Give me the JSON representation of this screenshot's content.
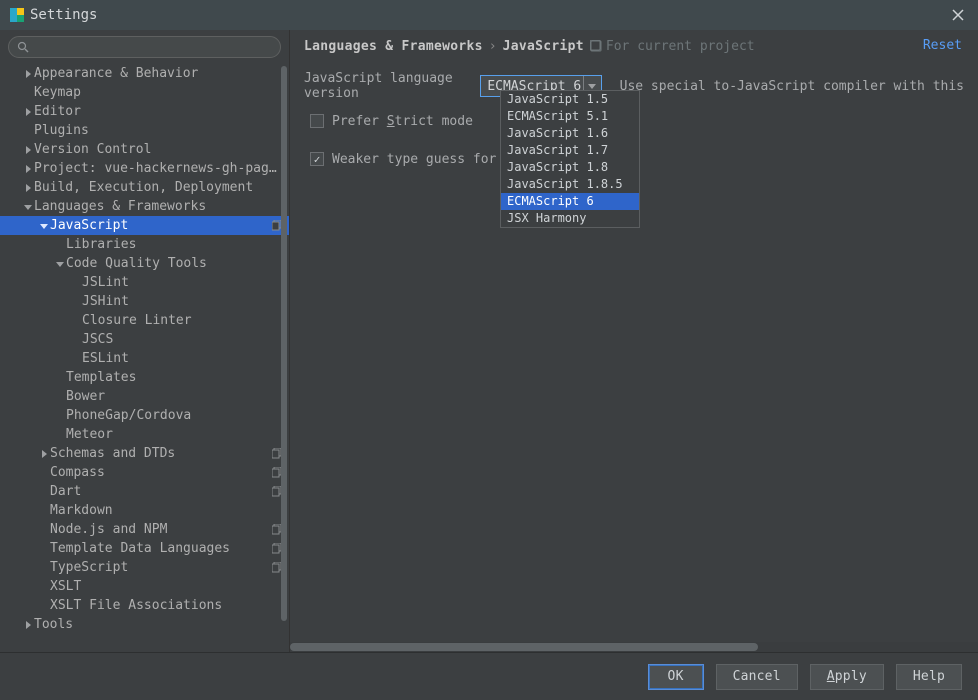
{
  "window": {
    "title": "Settings"
  },
  "search": {
    "placeholder": ""
  },
  "tree": [
    {
      "label": "Appearance & Behavior",
      "indent": 0,
      "arrow": "right"
    },
    {
      "label": "Keymap",
      "indent": 0,
      "arrow": "none"
    },
    {
      "label": "Editor",
      "indent": 0,
      "arrow": "right"
    },
    {
      "label": "Plugins",
      "indent": 0,
      "arrow": "none"
    },
    {
      "label": "Version Control",
      "indent": 0,
      "arrow": "right"
    },
    {
      "label": "Project: vue-hackernews-gh-pag...",
      "indent": 0,
      "arrow": "right"
    },
    {
      "label": "Build, Execution, Deployment",
      "indent": 0,
      "arrow": "right"
    },
    {
      "label": "Languages & Frameworks",
      "indent": 0,
      "arrow": "down"
    },
    {
      "label": "JavaScript",
      "indent": 1,
      "arrow": "down",
      "copy": true,
      "selected": true
    },
    {
      "label": "Libraries",
      "indent": 2,
      "arrow": "none"
    },
    {
      "label": "Code Quality Tools",
      "indent": 2,
      "arrow": "down"
    },
    {
      "label": "JSLint",
      "indent": 3,
      "arrow": "none"
    },
    {
      "label": "JSHint",
      "indent": 3,
      "arrow": "none"
    },
    {
      "label": "Closure Linter",
      "indent": 3,
      "arrow": "none"
    },
    {
      "label": "JSCS",
      "indent": 3,
      "arrow": "none"
    },
    {
      "label": "ESLint",
      "indent": 3,
      "arrow": "none"
    },
    {
      "label": "Templates",
      "indent": 2,
      "arrow": "none"
    },
    {
      "label": "Bower",
      "indent": 2,
      "arrow": "none"
    },
    {
      "label": "PhoneGap/Cordova",
      "indent": 2,
      "arrow": "none"
    },
    {
      "label": "Meteor",
      "indent": 2,
      "arrow": "none"
    },
    {
      "label": "Schemas and DTDs",
      "indent": 1,
      "arrow": "right",
      "copy": true
    },
    {
      "label": "Compass",
      "indent": 1,
      "arrow": "none",
      "copy": true
    },
    {
      "label": "Dart",
      "indent": 1,
      "arrow": "none",
      "copy": true
    },
    {
      "label": "Markdown",
      "indent": 1,
      "arrow": "none"
    },
    {
      "label": "Node.js and NPM",
      "indent": 1,
      "arrow": "none",
      "copy": true
    },
    {
      "label": "Template Data Languages",
      "indent": 1,
      "arrow": "none",
      "copy": true
    },
    {
      "label": "TypeScript",
      "indent": 1,
      "arrow": "none",
      "copy": true
    },
    {
      "label": "XSLT",
      "indent": 1,
      "arrow": "none"
    },
    {
      "label": "XSLT File Associations",
      "indent": 1,
      "arrow": "none"
    },
    {
      "label": "Tools",
      "indent": 0,
      "arrow": "right"
    }
  ],
  "breadcrumb": {
    "crumb1": "Languages & Frameworks",
    "sep": "›",
    "crumb2": "JavaScript",
    "project_scope": "For current project",
    "reset": "Reset"
  },
  "form": {
    "language_version_label": "JavaScript language version",
    "language_version_value": "ECMAScript 6",
    "compiler_hint": "Use special to-JavaScript compiler with this",
    "prefer_strict_label": "Prefer Strict mode",
    "prefer_strict_checked": false,
    "weaker_type_label": "Weaker type guess for completion",
    "weaker_type_label_visible": "Weaker type guess for com",
    "weaker_type_checked": true
  },
  "dropdown_options": [
    "JavaScript 1.5",
    "ECMAScript 5.1",
    "JavaScript 1.6",
    "JavaScript 1.7",
    "JavaScript 1.8",
    "JavaScript 1.8.5",
    "ECMAScript 6",
    "JSX Harmony"
  ],
  "dropdown_active_index": 6,
  "buttons": {
    "ok": "OK",
    "cancel": "Cancel",
    "apply": "Apply",
    "help": "Help"
  },
  "sidebar_scrollbar": {
    "thumb_top_pct": 0,
    "thumb_height_pct": 95
  },
  "main_hscrollbar": {
    "thumb_left_pct": 0,
    "thumb_width_pct": 68
  }
}
